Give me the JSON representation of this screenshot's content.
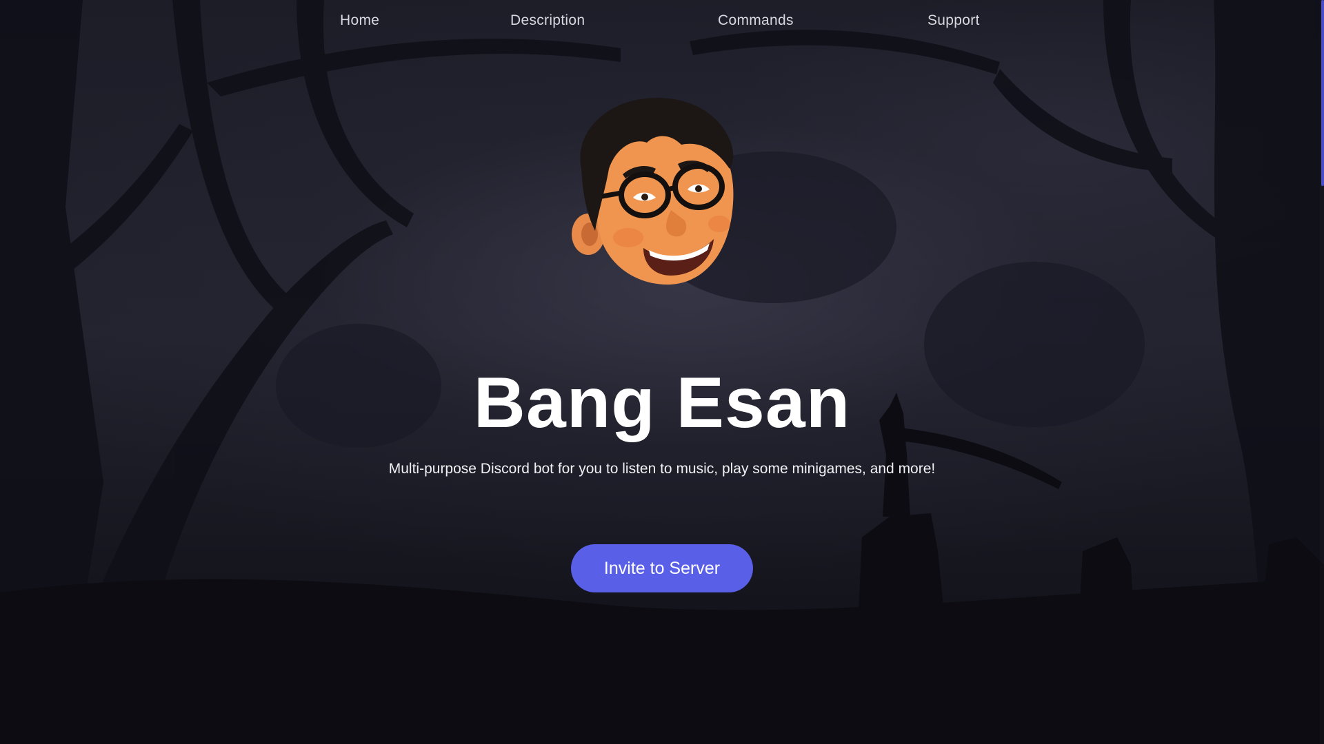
{
  "nav": {
    "items": [
      {
        "label": "Home"
      },
      {
        "label": "Description"
      },
      {
        "label": "Commands"
      },
      {
        "label": "Support"
      }
    ]
  },
  "hero": {
    "title": "Bang Esan",
    "subtitle": "Multi-purpose Discord bot for you to listen to music, play some minigames, and more!",
    "invite_label": "Invite to Server"
  },
  "colors": {
    "accent": "#5a5fe8",
    "background": "#1d1d28",
    "nav_text": "#d8d8e0"
  },
  "icons": {
    "avatar": "bot-avatar-face"
  }
}
